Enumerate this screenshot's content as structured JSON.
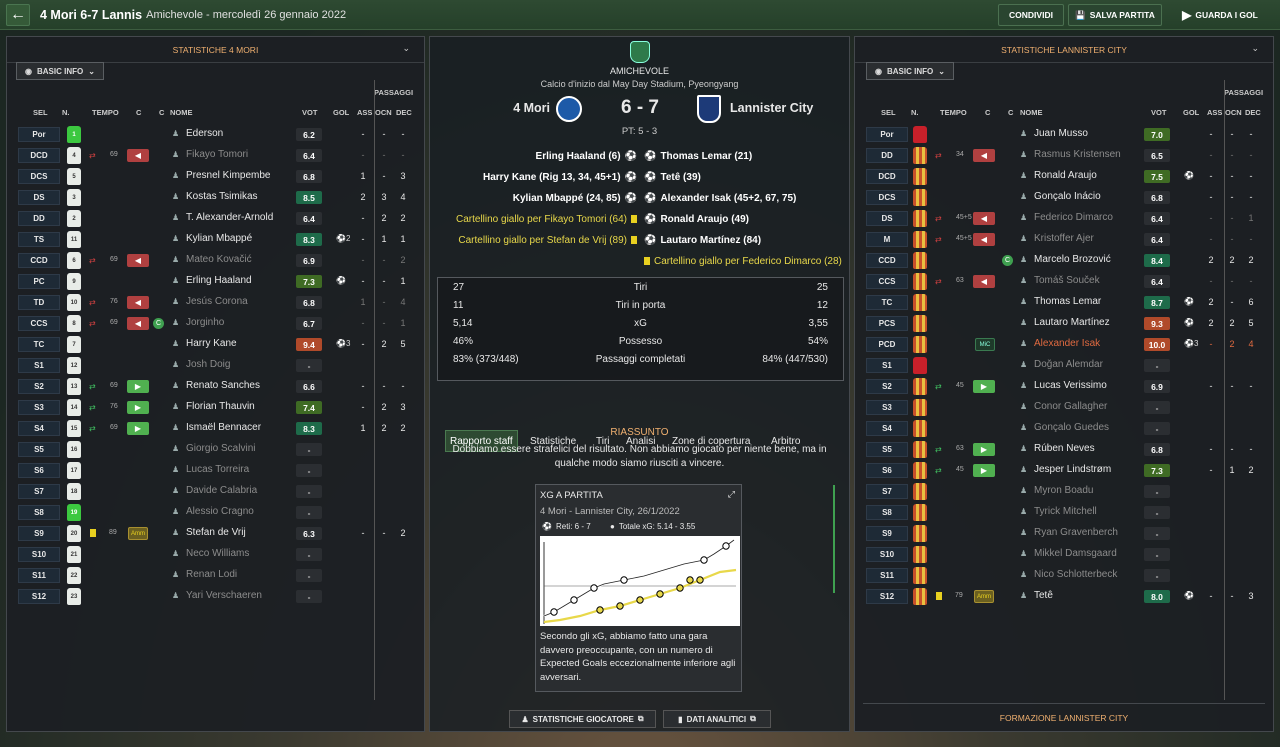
{
  "topbar": {
    "title": "4 Mori 6-7 Lannis",
    "subtitle": "Amichevole - mercoledì 26 gennaio 2022",
    "share_label": "CONDIVIDI",
    "save_label": "SALVA PARTITA",
    "watch_label": "GUARDA I GOL"
  },
  "colors": {
    "green_rating": "#1e6b4a",
    "yellow_rating": "#4a6b1e",
    "red_rating": "#b04a2a",
    "accent_orange": "#f0b070",
    "shirt_home": "#e8ece8",
    "shirt_away": "#c8502a"
  },
  "left": {
    "header": "STATISTICHE 4 MORI",
    "basic_info": "BASIC INFO",
    "col": {
      "sel": "SEL",
      "n": "N.",
      "tempo": "TEMPO",
      "c1": "C",
      "c2": "C",
      "nome": "NOME",
      "vot": "VOT",
      "gol": "GOL",
      "ass": "ASS",
      "passaggi": "PASSAGGI",
      "ocn": "OCN",
      "dec": "DEC"
    },
    "rows": [
      {
        "pos": "Por",
        "n": "1",
        "time": "",
        "sub": "",
        "name": "Ederson",
        "dim": false,
        "vot": "6.2",
        "gol": "",
        "ass": "-",
        "ocn": "-",
        "dec": "-"
      },
      {
        "pos": "DCD",
        "n": "4",
        "time": "69",
        "sub": "out",
        "name": "Fikayo Tomori",
        "dim": true,
        "vot": "6.4",
        "gol": "",
        "ass": "-",
        "ocn": "-",
        "dec": "-"
      },
      {
        "pos": "DCS",
        "n": "5",
        "time": "",
        "sub": "",
        "name": "Presnel Kimpembe",
        "dim": false,
        "vot": "6.8",
        "gol": "",
        "ass": "1",
        "ocn": "-",
        "dec": "3"
      },
      {
        "pos": "DS",
        "n": "3",
        "time": "",
        "sub": "",
        "name": "Kostas Tsimikas",
        "dim": false,
        "vot": "8.5",
        "gol": "",
        "ass": "2",
        "ocn": "3",
        "dec": "4"
      },
      {
        "pos": "DD",
        "n": "2",
        "time": "",
        "sub": "",
        "name": "T. Alexander-Arnold",
        "dim": false,
        "vot": "6.4",
        "gol": "",
        "ass": "-",
        "ocn": "2",
        "dec": "2"
      },
      {
        "pos": "TS",
        "n": "11",
        "time": "",
        "sub": "",
        "name": "Kylian Mbappé",
        "dim": false,
        "vot": "8.3",
        "gol": "2",
        "ass": "-",
        "ocn": "1",
        "dec": "1"
      },
      {
        "pos": "CCD",
        "n": "6",
        "time": "69",
        "sub": "out",
        "name": "Mateo Kovačić",
        "dim": true,
        "vot": "6.9",
        "gol": "",
        "ass": "-",
        "ocn": "-",
        "dec": "2"
      },
      {
        "pos": "PC",
        "n": "9",
        "time": "",
        "sub": "",
        "name": "Erling Haaland",
        "dim": false,
        "vot": "7.3",
        "gol": "1",
        "ass": "-",
        "ocn": "-",
        "dec": "1"
      },
      {
        "pos": "TD",
        "n": "10",
        "time": "76",
        "sub": "out",
        "name": "Jesús Corona",
        "dim": true,
        "vot": "6.8",
        "gol": "",
        "ass": "1",
        "ocn": "-",
        "dec": "4"
      },
      {
        "pos": "CCS",
        "n": "8",
        "time": "69",
        "sub": "out",
        "name": "Jorginho",
        "dim": true,
        "vot": "6.7",
        "gol": "",
        "ass": "-",
        "ocn": "-",
        "dec": "1"
      },
      {
        "pos": "TC",
        "n": "7",
        "time": "",
        "sub": "",
        "name": "Harry Kane",
        "dim": false,
        "vot": "9.4",
        "gol": "3",
        "ass": "-",
        "ocn": "2",
        "dec": "5"
      },
      {
        "pos": "S1",
        "n": "12",
        "time": "",
        "sub": "",
        "name": "Josh Doig",
        "dim": true,
        "vot": "-",
        "gol": "",
        "ass": "",
        "ocn": "",
        "dec": ""
      },
      {
        "pos": "S2",
        "n": "13",
        "time": "69",
        "sub": "in",
        "name": "Renato Sanches",
        "dim": false,
        "vot": "6.6",
        "gol": "",
        "ass": "-",
        "ocn": "-",
        "dec": "-"
      },
      {
        "pos": "S3",
        "n": "14",
        "time": "76",
        "sub": "in",
        "name": "Florian Thauvin",
        "dim": false,
        "vot": "7.4",
        "gol": "",
        "ass": "-",
        "ocn": "2",
        "dec": "3"
      },
      {
        "pos": "S4",
        "n": "15",
        "time": "69",
        "sub": "in",
        "name": "Ismaël Bennacer",
        "dim": false,
        "vot": "8.3",
        "gol": "",
        "ass": "1",
        "ocn": "2",
        "dec": "2"
      },
      {
        "pos": "S5",
        "n": "16",
        "time": "",
        "sub": "",
        "name": "Giorgio Scalvini",
        "dim": true,
        "vot": "-",
        "gol": "",
        "ass": "",
        "ocn": "",
        "dec": ""
      },
      {
        "pos": "S6",
        "n": "17",
        "time": "",
        "sub": "",
        "name": "Lucas Torreira",
        "dim": true,
        "vot": "-",
        "gol": "",
        "ass": "",
        "ocn": "",
        "dec": ""
      },
      {
        "pos": "S7",
        "n": "18",
        "time": "",
        "sub": "",
        "name": "Davide Calabria",
        "dim": true,
        "vot": "-",
        "gol": "",
        "ass": "",
        "ocn": "",
        "dec": ""
      },
      {
        "pos": "S8",
        "n": "19",
        "time": "",
        "sub": "",
        "name": "Alessio Cragno",
        "dim": true,
        "vot": "-",
        "gol": "",
        "ass": "",
        "ocn": "",
        "dec": ""
      },
      {
        "pos": "S9",
        "n": "20",
        "time": "89",
        "sub": "amm",
        "name": "Stefan de Vrij",
        "dim": false,
        "vot": "6.3",
        "gol": "",
        "ass": "-",
        "ocn": "-",
        "dec": "2"
      },
      {
        "pos": "S10",
        "n": "21",
        "time": "",
        "sub": "",
        "name": "Neco Williams",
        "dim": true,
        "vot": "-",
        "gol": "",
        "ass": "",
        "ocn": "",
        "dec": ""
      },
      {
        "pos": "S11",
        "n": "22",
        "time": "",
        "sub": "",
        "name": "Renan Lodi",
        "dim": true,
        "vot": "-",
        "gol": "",
        "ass": "",
        "ocn": "",
        "dec": ""
      },
      {
        "pos": "S12",
        "n": "23",
        "time": "",
        "sub": "",
        "name": "Yari Verschaeren",
        "dim": true,
        "vot": "-",
        "gol": "",
        "ass": "",
        "ocn": "",
        "dec": ""
      }
    ]
  },
  "right": {
    "header": "STATISTICHE LANNISTER CITY",
    "footer": "FORMAZIONE LANNISTER CITY",
    "basic_info": "BASIC INFO",
    "rows": [
      {
        "pos": "Por",
        "time": "",
        "sub": "",
        "name": "Juan Musso",
        "dim": false,
        "vot": "7.0",
        "gol": "",
        "ass": "-",
        "ocn": "-",
        "dec": "-"
      },
      {
        "pos": "DD",
        "time": "34",
        "sub": "out",
        "name": "Rasmus Kristensen",
        "dim": true,
        "vot": "6.5",
        "gol": "",
        "ass": "-",
        "ocn": "-",
        "dec": "-"
      },
      {
        "pos": "DCD",
        "time": "",
        "sub": "",
        "name": "Ronald Araujo",
        "dim": false,
        "vot": "7.5",
        "gol": "1",
        "ass": "-",
        "ocn": "-",
        "dec": "-"
      },
      {
        "pos": "DCS",
        "time": "",
        "sub": "",
        "name": "Gonçalo Inácio",
        "dim": false,
        "vot": "6.8",
        "gol": "",
        "ass": "-",
        "ocn": "-",
        "dec": "-"
      },
      {
        "pos": "DS",
        "time": "45+5",
        "sub": "out",
        "name": "Federico Dimarco",
        "dim": true,
        "vot": "6.4",
        "gol": "",
        "ass": "-",
        "ocn": "-",
        "dec": "1"
      },
      {
        "pos": "M",
        "time": "45+5",
        "sub": "out",
        "name": "Kristoffer Ajer",
        "dim": true,
        "vot": "6.4",
        "gol": "",
        "ass": "-",
        "ocn": "-",
        "dec": "-"
      },
      {
        "pos": "CCD",
        "time": "",
        "sub": "c",
        "name": "Marcelo Brozović",
        "dim": false,
        "vot": "8.4",
        "gol": "",
        "ass": "2",
        "ocn": "2",
        "dec": "2"
      },
      {
        "pos": "CCS",
        "time": "63",
        "sub": "out",
        "name": "Tomáš Souček",
        "dim": true,
        "vot": "6.4",
        "gol": "",
        "ass": "-",
        "ocn": "-",
        "dec": "-"
      },
      {
        "pos": "TC",
        "time": "",
        "sub": "",
        "name": "Thomas Lemar",
        "dim": false,
        "vot": "8.7",
        "gol": "1",
        "ass": "2",
        "ocn": "-",
        "dec": "6"
      },
      {
        "pos": "PCS",
        "time": "",
        "sub": "",
        "name": "Lautaro Martínez",
        "dim": false,
        "vot": "9.3",
        "gol": "1",
        "ass": "2",
        "ocn": "2",
        "dec": "5"
      },
      {
        "pos": "PCD",
        "time": "",
        "sub": "mic",
        "name": "Alexander Isak",
        "dim": false,
        "red": true,
        "vot": "10.0",
        "gol": "3",
        "ass": "-",
        "ocn": "2",
        "dec": "4"
      },
      {
        "pos": "S1",
        "time": "",
        "sub": "",
        "name": "Doğan Alemdar",
        "dim": true,
        "vot": "-",
        "gol": "",
        "ass": "",
        "ocn": "",
        "dec": ""
      },
      {
        "pos": "S2",
        "time": "45",
        "sub": "in",
        "name": "Lucas Verissimo",
        "dim": false,
        "vot": "6.9",
        "gol": "",
        "ass": "-",
        "ocn": "-",
        "dec": "-"
      },
      {
        "pos": "S3",
        "time": "",
        "sub": "",
        "name": "Conor Gallagher",
        "dim": true,
        "vot": "-",
        "gol": "",
        "ass": "",
        "ocn": "",
        "dec": ""
      },
      {
        "pos": "S4",
        "time": "",
        "sub": "",
        "name": "Gonçalo Guedes",
        "dim": true,
        "vot": "-",
        "gol": "",
        "ass": "",
        "ocn": "",
        "dec": ""
      },
      {
        "pos": "S5",
        "time": "63",
        "sub": "in",
        "name": "Rúben Neves",
        "dim": false,
        "vot": "6.8",
        "gol": "",
        "ass": "-",
        "ocn": "-",
        "dec": "-"
      },
      {
        "pos": "S6",
        "time": "45",
        "sub": "in",
        "name": "Jesper Lindstrøm",
        "dim": false,
        "vot": "7.3",
        "gol": "",
        "ass": "-",
        "ocn": "1",
        "dec": "2"
      },
      {
        "pos": "S7",
        "time": "",
        "sub": "",
        "name": "Myron Boadu",
        "dim": true,
        "vot": "-",
        "gol": "",
        "ass": "",
        "ocn": "",
        "dec": ""
      },
      {
        "pos": "S8",
        "time": "",
        "sub": "",
        "name": "Tyrick Mitchell",
        "dim": true,
        "vot": "-",
        "gol": "",
        "ass": "",
        "ocn": "",
        "dec": ""
      },
      {
        "pos": "S9",
        "time": "",
        "sub": "",
        "name": "Ryan Gravenberch",
        "dim": true,
        "vot": "-",
        "gol": "",
        "ass": "",
        "ocn": "",
        "dec": ""
      },
      {
        "pos": "S10",
        "time": "",
        "sub": "",
        "name": "Mikkel Damsgaard",
        "dim": true,
        "vot": "-",
        "gol": "",
        "ass": "",
        "ocn": "",
        "dec": ""
      },
      {
        "pos": "S11",
        "time": "",
        "sub": "",
        "name": "Nico Schlotterbeck",
        "dim": true,
        "vot": "-",
        "gol": "",
        "ass": "",
        "ocn": "",
        "dec": ""
      },
      {
        "pos": "S12",
        "time": "79",
        "sub": "amm",
        "name": "Tetê",
        "dim": false,
        "vot": "8.0",
        "gol": "1",
        "ass": "-",
        "ocn": "-",
        "dec": "3"
      }
    ]
  },
  "match": {
    "competition": "AMICHEVOLE",
    "venue": "Calcio d'inizio dal May Day Stadium, Pyeongyang",
    "home": "4 Mori",
    "away": "Lannister City",
    "score": "6 - 7",
    "pens": "PT: 5 - 3",
    "home_events": [
      "Erling Haaland (6)",
      "Harry Kane (Rig 13, 34, 45+1)",
      "Kylian Mbappé (24, 85)",
      "Cartellino giallo per Fikayo Tomori (64)",
      "Cartellino giallo per Stefan de Vrij (89)"
    ],
    "away_events": [
      "Thomas Lemar (21)",
      "Tetê (39)",
      "Alexander Isak (45+2, 67, 75)",
      "Ronald Araujo (49)",
      "Lautaro Martínez (84)",
      "Cartellino giallo per Federico Dimarco (28)"
    ],
    "stats": [
      {
        "h": "27",
        "label": "Tiri",
        "a": "25"
      },
      {
        "h": "11",
        "label": "Tiri in porta",
        "a": "12"
      },
      {
        "h": "5,14",
        "label": "xG",
        "a": "3,55"
      },
      {
        "h": "46%",
        "label": "Possesso",
        "a": "54%"
      },
      {
        "h": "83% (373/448)",
        "label": "Passaggi completati",
        "a": "84% (447/530)"
      }
    ],
    "tabs": [
      "Rapporto staff",
      "Statistiche",
      "Tiri",
      "Analisi",
      "Zone di copertura",
      "Arbitro"
    ],
    "summary_title": "RIASSUNTO",
    "summary_text": "Dobbiamo essere strafelici del risultato. Non abbiamo giocato per niente bene, ma in qualche modo siamo riusciti a vincere.",
    "xg": {
      "title": "XG A PARTITA",
      "subtitle": "4 Mori - Lannister City, 26/1/2022",
      "goals": "Reti: 6 - 7",
      "total": "Totale xG: 5.14 - 3.55",
      "text": "Secondo gli xG, abbiamo fatto una gara davvero preoccupante, con un numero di Expected Goals eccezionalmente inferiore agli avversari."
    },
    "btn_players": "STATISTICHE GIOCATORE",
    "btn_analytics": "DATI ANALITICI"
  }
}
